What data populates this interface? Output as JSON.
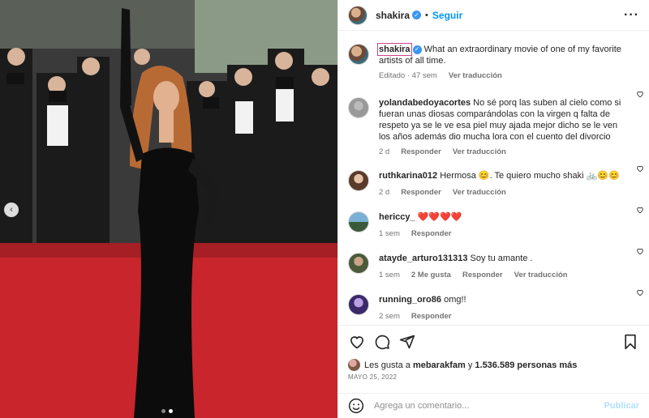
{
  "post": {
    "author": "shakira",
    "follow_label": "Seguir",
    "separator": "•",
    "more_label": "···",
    "caption_author": "shakira",
    "caption_text": "What an extraordinary movie of one of my favorite artists of all time.",
    "caption_meta": {
      "status": "Editado",
      "time": "47 sem",
      "translate": "Ver traducción"
    }
  },
  "comments": [
    {
      "user": "yolandabedoyacortes",
      "text": "No sé porq las suben al cielo como si fueran unas diosas comparándolas con la virgen q falta de respeto ya se le ve esa piel muy ajada mejor dicho se le ven los años además dio mucha lora con el cuento del divorcio",
      "time": "2 d",
      "reply": "Responder",
      "translate": "Ver traducción"
    },
    {
      "user": "ruthkarina012",
      "text": "Hermosa 😊. Te quiero mucho shaki 🚲😊😊",
      "time": "2 d",
      "reply": "Responder",
      "translate": "Ver traducción"
    },
    {
      "user": "hericcy_",
      "text": "❤️❤️❤️❤️",
      "time": "1 sem",
      "reply": "Responder"
    },
    {
      "user": "atayde_arturo131313",
      "text": "Soy tu amante .",
      "time": "1 sem",
      "likes": "2 Me gusta",
      "reply": "Responder",
      "translate": "Ver traducción"
    },
    {
      "user": "running_oro86",
      "text": "omg!!",
      "time": "2 sem",
      "reply": "Responder"
    }
  ],
  "likes_line": {
    "prefix": "Les gusta a",
    "user": "mebarakfam",
    "and": "y",
    "count": "1.536.589 personas más"
  },
  "date": "MAYO 25, 2022",
  "composer": {
    "placeholder": "Agrega un comentario...",
    "publish": "Publicar"
  },
  "colors": {
    "accent": "#0095f6",
    "verified": "#3897f0",
    "muted": "#737373",
    "carpet": "#c8262c"
  },
  "icons": [
    "heart-icon",
    "comment-icon",
    "share-icon",
    "save-icon",
    "emoji-icon",
    "verified-icon",
    "chevron-left-icon"
  ]
}
